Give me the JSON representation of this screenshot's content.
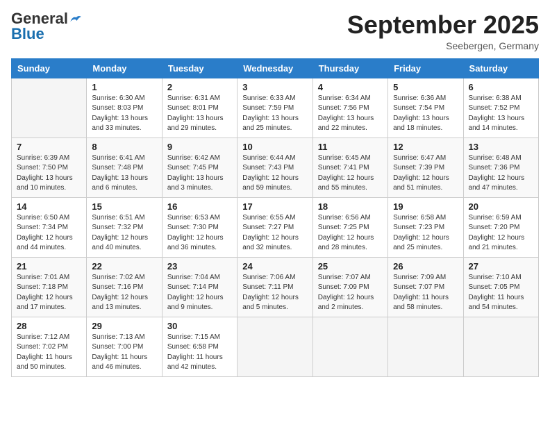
{
  "header": {
    "logo_general": "General",
    "logo_blue": "Blue",
    "month_title": "September 2025",
    "location": "Seebergen, Germany"
  },
  "weekdays": [
    "Sunday",
    "Monday",
    "Tuesday",
    "Wednesday",
    "Thursday",
    "Friday",
    "Saturday"
  ],
  "weeks": [
    [
      {
        "day": "",
        "info": ""
      },
      {
        "day": "1",
        "info": "Sunrise: 6:30 AM\nSunset: 8:03 PM\nDaylight: 13 hours\nand 33 minutes."
      },
      {
        "day": "2",
        "info": "Sunrise: 6:31 AM\nSunset: 8:01 PM\nDaylight: 13 hours\nand 29 minutes."
      },
      {
        "day": "3",
        "info": "Sunrise: 6:33 AM\nSunset: 7:59 PM\nDaylight: 13 hours\nand 25 minutes."
      },
      {
        "day": "4",
        "info": "Sunrise: 6:34 AM\nSunset: 7:56 PM\nDaylight: 13 hours\nand 22 minutes."
      },
      {
        "day": "5",
        "info": "Sunrise: 6:36 AM\nSunset: 7:54 PM\nDaylight: 13 hours\nand 18 minutes."
      },
      {
        "day": "6",
        "info": "Sunrise: 6:38 AM\nSunset: 7:52 PM\nDaylight: 13 hours\nand 14 minutes."
      }
    ],
    [
      {
        "day": "7",
        "info": "Sunrise: 6:39 AM\nSunset: 7:50 PM\nDaylight: 13 hours\nand 10 minutes."
      },
      {
        "day": "8",
        "info": "Sunrise: 6:41 AM\nSunset: 7:48 PM\nDaylight: 13 hours\nand 6 minutes."
      },
      {
        "day": "9",
        "info": "Sunrise: 6:42 AM\nSunset: 7:45 PM\nDaylight: 13 hours\nand 3 minutes."
      },
      {
        "day": "10",
        "info": "Sunrise: 6:44 AM\nSunset: 7:43 PM\nDaylight: 12 hours\nand 59 minutes."
      },
      {
        "day": "11",
        "info": "Sunrise: 6:45 AM\nSunset: 7:41 PM\nDaylight: 12 hours\nand 55 minutes."
      },
      {
        "day": "12",
        "info": "Sunrise: 6:47 AM\nSunset: 7:39 PM\nDaylight: 12 hours\nand 51 minutes."
      },
      {
        "day": "13",
        "info": "Sunrise: 6:48 AM\nSunset: 7:36 PM\nDaylight: 12 hours\nand 47 minutes."
      }
    ],
    [
      {
        "day": "14",
        "info": "Sunrise: 6:50 AM\nSunset: 7:34 PM\nDaylight: 12 hours\nand 44 minutes."
      },
      {
        "day": "15",
        "info": "Sunrise: 6:51 AM\nSunset: 7:32 PM\nDaylight: 12 hours\nand 40 minutes."
      },
      {
        "day": "16",
        "info": "Sunrise: 6:53 AM\nSunset: 7:30 PM\nDaylight: 12 hours\nand 36 minutes."
      },
      {
        "day": "17",
        "info": "Sunrise: 6:55 AM\nSunset: 7:27 PM\nDaylight: 12 hours\nand 32 minutes."
      },
      {
        "day": "18",
        "info": "Sunrise: 6:56 AM\nSunset: 7:25 PM\nDaylight: 12 hours\nand 28 minutes."
      },
      {
        "day": "19",
        "info": "Sunrise: 6:58 AM\nSunset: 7:23 PM\nDaylight: 12 hours\nand 25 minutes."
      },
      {
        "day": "20",
        "info": "Sunrise: 6:59 AM\nSunset: 7:20 PM\nDaylight: 12 hours\nand 21 minutes."
      }
    ],
    [
      {
        "day": "21",
        "info": "Sunrise: 7:01 AM\nSunset: 7:18 PM\nDaylight: 12 hours\nand 17 minutes."
      },
      {
        "day": "22",
        "info": "Sunrise: 7:02 AM\nSunset: 7:16 PM\nDaylight: 12 hours\nand 13 minutes."
      },
      {
        "day": "23",
        "info": "Sunrise: 7:04 AM\nSunset: 7:14 PM\nDaylight: 12 hours\nand 9 minutes."
      },
      {
        "day": "24",
        "info": "Sunrise: 7:06 AM\nSunset: 7:11 PM\nDaylight: 12 hours\nand 5 minutes."
      },
      {
        "day": "25",
        "info": "Sunrise: 7:07 AM\nSunset: 7:09 PM\nDaylight: 12 hours\nand 2 minutes."
      },
      {
        "day": "26",
        "info": "Sunrise: 7:09 AM\nSunset: 7:07 PM\nDaylight: 11 hours\nand 58 minutes."
      },
      {
        "day": "27",
        "info": "Sunrise: 7:10 AM\nSunset: 7:05 PM\nDaylight: 11 hours\nand 54 minutes."
      }
    ],
    [
      {
        "day": "28",
        "info": "Sunrise: 7:12 AM\nSunset: 7:02 PM\nDaylight: 11 hours\nand 50 minutes."
      },
      {
        "day": "29",
        "info": "Sunrise: 7:13 AM\nSunset: 7:00 PM\nDaylight: 11 hours\nand 46 minutes."
      },
      {
        "day": "30",
        "info": "Sunrise: 7:15 AM\nSunset: 6:58 PM\nDaylight: 11 hours\nand 42 minutes."
      },
      {
        "day": "",
        "info": ""
      },
      {
        "day": "",
        "info": ""
      },
      {
        "day": "",
        "info": ""
      },
      {
        "day": "",
        "info": ""
      }
    ]
  ]
}
